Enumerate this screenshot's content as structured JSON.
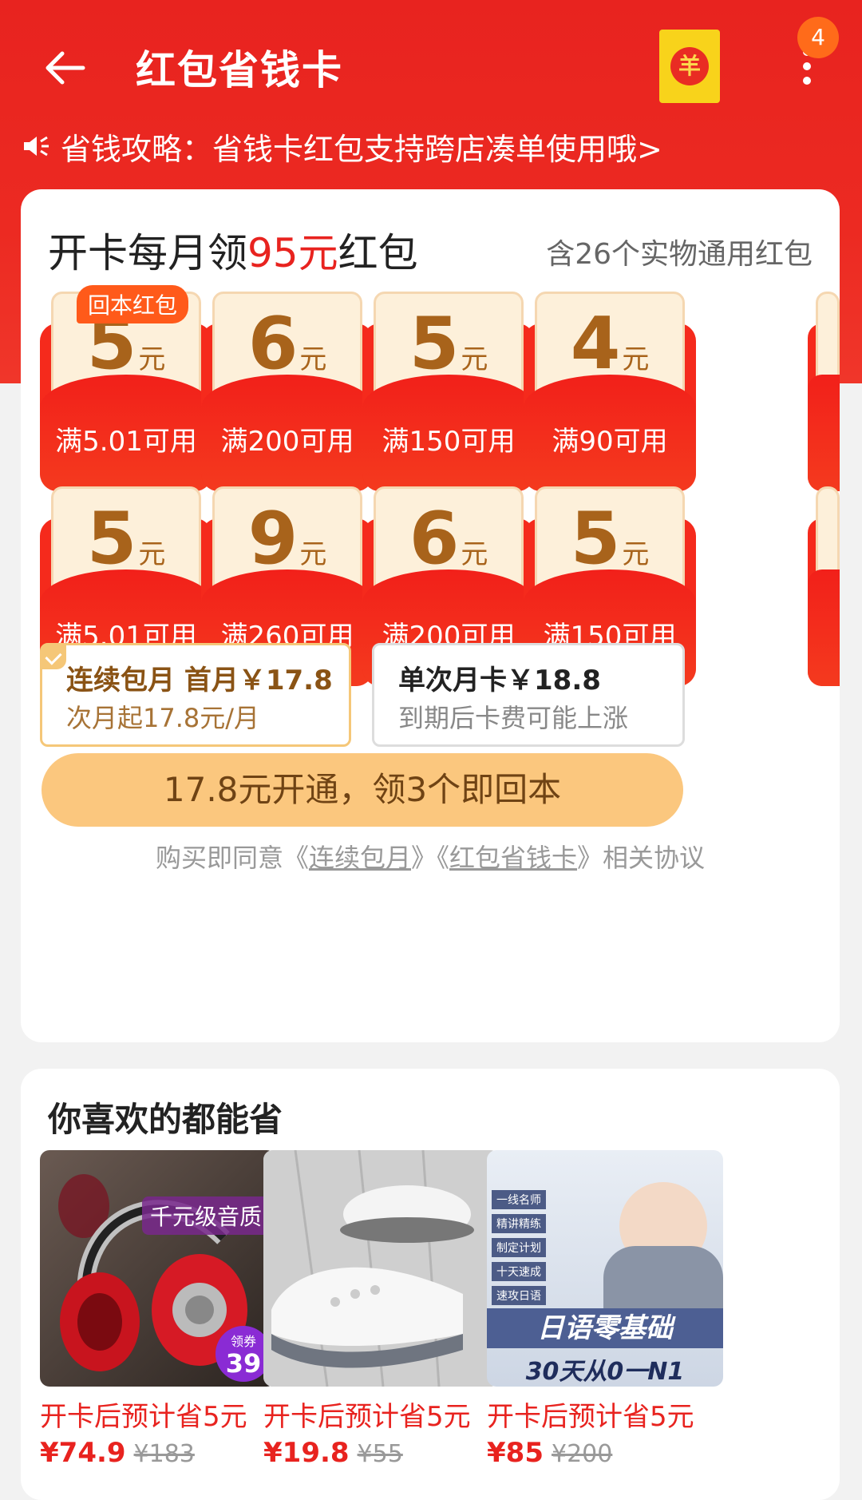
{
  "header": {
    "title": "红包省钱卡",
    "badge_count": "4",
    "redpacket_symbol": "羊",
    "notice": "省钱攻略：省钱卡红包支持跨店凑单使用哦>"
  },
  "card": {
    "headline_prefix": "开卡每月领",
    "headline_amount": "95元",
    "headline_suffix": "红包",
    "subtitle": "含26个实物通用红包",
    "tag": "回本红包",
    "unit": "元",
    "packets_row1": [
      {
        "amount": "5",
        "cond": "满5.01可用"
      },
      {
        "amount": "6",
        "cond": "满200可用"
      },
      {
        "amount": "5",
        "cond": "满150可用"
      },
      {
        "amount": "4",
        "cond": "满90可用"
      }
    ],
    "packets_row2": [
      {
        "amount": "5",
        "cond": "满5.01可用"
      },
      {
        "amount": "9",
        "cond": "满260可用"
      },
      {
        "amount": "6",
        "cond": "满200可用"
      },
      {
        "amount": "5",
        "cond": "满150可用"
      }
    ],
    "plan_monthly": {
      "title": "连续包月 首月￥17.8",
      "sub": "次月起17.8元/月"
    },
    "plan_single": {
      "title": "单次月卡￥18.8",
      "sub": "到期后卡费可能上涨"
    },
    "cta": "17.8元开通，领3个即回本",
    "agree_prefix": "购买即同意《",
    "agree_link1": "连续包月",
    "agree_mid": "》《",
    "agree_link2": "红包省钱卡",
    "agree_suffix": "》相关协议"
  },
  "likes": {
    "title": "你喜欢的都能省",
    "products": [
      {
        "save": "开卡后预计省5元",
        "price": "¥74.9",
        "original": "¥183",
        "img_label": "千元级音质",
        "img_price": "39",
        "img_price_tag": "领券"
      },
      {
        "save": "开卡后预计省5元",
        "price": "¥19.8",
        "original": "¥55"
      },
      {
        "save": "开卡后预计省5元",
        "price": "¥85",
        "original": "¥200",
        "img_lines": [
          "一线名师",
          "精讲精练",
          "制定计划",
          "十天速成",
          "速攻日语"
        ],
        "img_title": "日语零基础",
        "img_sub": "30天从0一N1"
      }
    ]
  }
}
